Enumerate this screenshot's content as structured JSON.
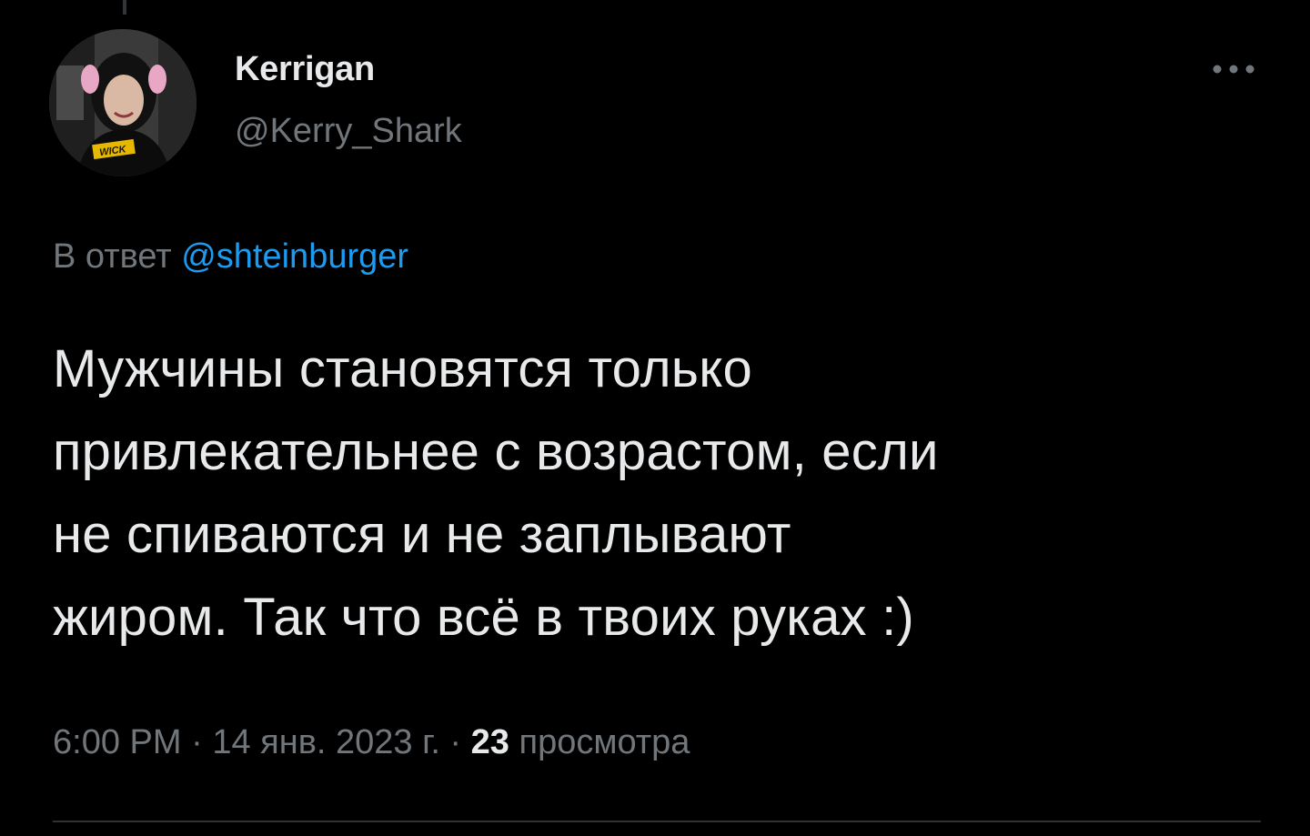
{
  "author": {
    "display_name": "Kerrigan",
    "handle": "@Kerry_Shark",
    "avatar_shirt_text": "WICK"
  },
  "reply": {
    "prefix": "В ответ",
    "mention": "@shteinburger"
  },
  "tweet": {
    "lines": [
      "Мужчины становятся только",
      "привлекательнее с возрастом, если",
      "не спиваются и не заплывают",
      "жиром. Так что всё в твоих руках :)"
    ]
  },
  "meta": {
    "time": "6:00 PM",
    "separator": " · ",
    "date": "14 янв. 2023 г.",
    "views_count": "23",
    "views_label": "просмотра"
  },
  "icons": {
    "more": "more-horizontal-icon"
  },
  "colors": {
    "background": "#000000",
    "text_primary": "#e7e9ea",
    "text_secondary": "#71767b",
    "link": "#1d9bf0",
    "divider": "#2f3336"
  }
}
